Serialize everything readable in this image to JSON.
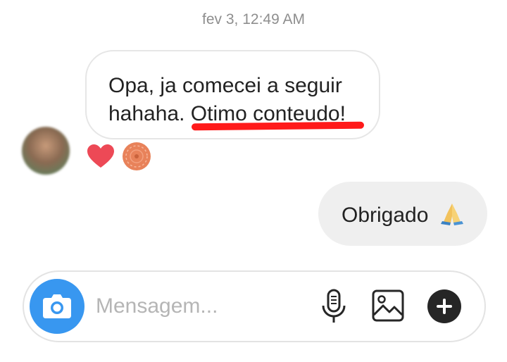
{
  "timestamp": "fev 3, 12:49 AM",
  "incoming_message": {
    "line1": "Opa, ja comecei a seguir",
    "line2_prefix": "hahaha. ",
    "line2_highlight": "Otimo conteudo!",
    "reactions": [
      "heart-icon",
      "cookie-emoji"
    ]
  },
  "outgoing_message": {
    "text": "Obrigado",
    "emoji": "pray-emoji"
  },
  "composer": {
    "placeholder": "Mensagem...",
    "icons": [
      "camera-icon",
      "microphone-icon",
      "gallery-icon",
      "plus-icon"
    ]
  },
  "colors": {
    "accent": "#3897f0",
    "annotation": "#ff1a1a",
    "heart": "#ed4956",
    "bubble_out": "#efefef"
  }
}
